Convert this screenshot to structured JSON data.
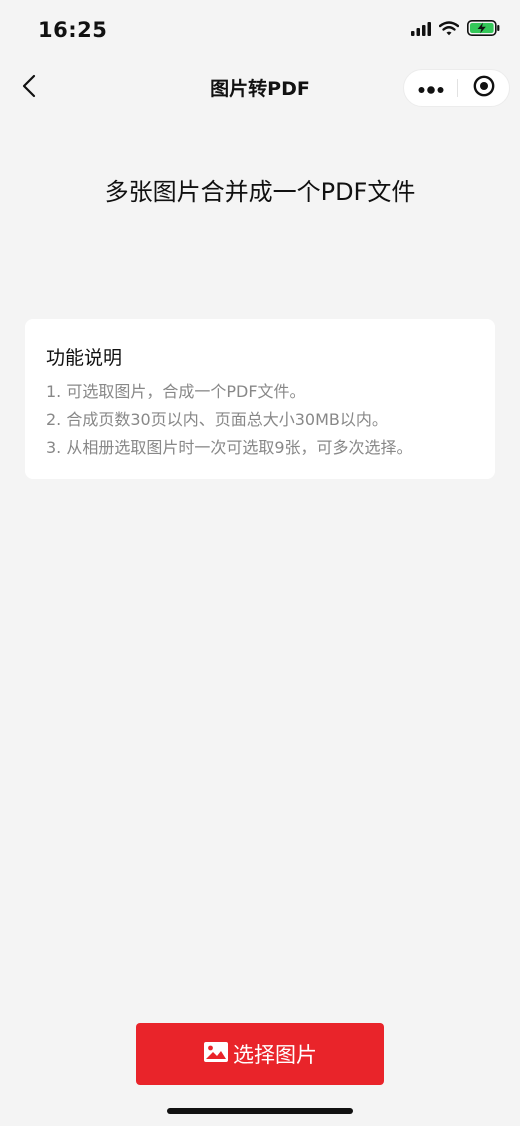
{
  "status_bar": {
    "time": "16:25"
  },
  "nav": {
    "title": "图片转PDF"
  },
  "main": {
    "headline": "多张图片合并成一个PDF文件"
  },
  "info": {
    "title": "功能说明",
    "lines": [
      "1. 可选取图片，合成一个PDF文件。",
      "2. 合成页数30页以内、页面总大小30MB以内。",
      "3. 从相册选取图片时一次可选取9张，可多次选择。"
    ]
  },
  "action": {
    "select_label": "选择图片",
    "color": "#e9242a"
  },
  "icons": {
    "signal": "cellular-signal-icon",
    "wifi": "wifi-icon",
    "battery": "battery-charging-icon",
    "back": "back-chevron-icon",
    "more": "more-dots-icon",
    "close": "miniprogram-close-icon",
    "image": "image-icon"
  }
}
